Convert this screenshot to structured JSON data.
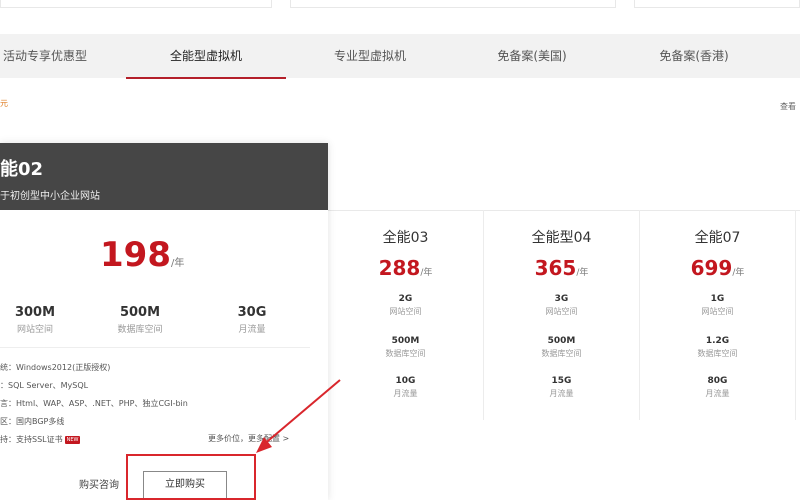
{
  "tabs": [
    {
      "label": "活动专享优惠型",
      "active": false
    },
    {
      "label": "全能型虚拟机",
      "active": true
    },
    {
      "label": "专业型虚拟机",
      "active": false
    },
    {
      "label": "免备案(美国)",
      "active": false
    },
    {
      "label": "免备案(香港)",
      "active": false
    }
  ],
  "note_left": "元",
  "note_right": "查看",
  "featured": {
    "title": "能02",
    "subtitle": "于初创型中小企业网站",
    "price": "198",
    "unit": "/年",
    "specs": [
      {
        "value": "300M",
        "label": "网站空间"
      },
      {
        "value": "500M",
        "label": "数据库空间"
      },
      {
        "value": "30G",
        "label": "月流量"
      }
    ],
    "details": [
      "统：Windows2012(正版授权)",
      "：SQL Server、MySQL",
      "言：Html、WAP、ASP、.NET、PHP、独立CGI-bin",
      "区：国内BGP多线",
      "持：支持SSL证书"
    ],
    "hot_badge": "NEW",
    "more_link": "更多价位，更多配置 >",
    "consult_label": "购买咨询",
    "buy_label": "立即购买"
  },
  "plans": [
    {
      "name": "全能03",
      "price": "288",
      "unit": "/年",
      "specs": [
        {
          "value": "2G",
          "label": "网站空间"
        },
        {
          "value": "500M",
          "label": "数据库空间"
        },
        {
          "value": "10G",
          "label": "月流量"
        }
      ]
    },
    {
      "name": "全能型04",
      "price": "365",
      "unit": "/年",
      "specs": [
        {
          "value": "3G",
          "label": "网站空间"
        },
        {
          "value": "500M",
          "label": "数据库空间"
        },
        {
          "value": "15G",
          "label": "月流量"
        }
      ]
    },
    {
      "name": "全能07",
      "price": "699",
      "unit": "/年",
      "specs": [
        {
          "value": "1G",
          "label": "网站空间"
        },
        {
          "value": "1.2G",
          "label": "数据库空间"
        },
        {
          "value": "80G",
          "label": "月流量"
        }
      ]
    }
  ],
  "colors": {
    "accent": "#c3171f",
    "annotation": "#d9262c",
    "header": "#464646"
  }
}
